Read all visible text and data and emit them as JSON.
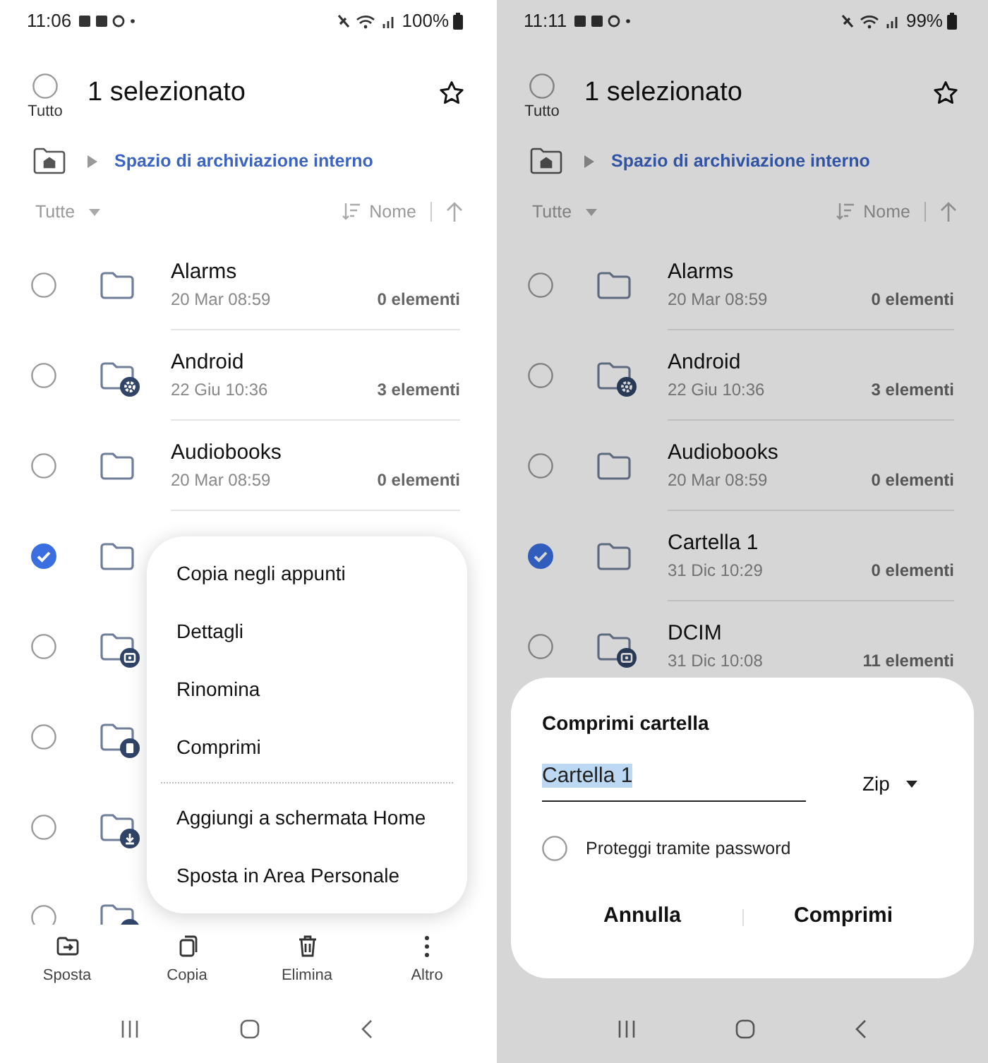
{
  "screens": [
    {
      "dimmed": false,
      "status_bar": {
        "time": "11:06",
        "battery": "100%"
      },
      "header": {
        "select_all": "Tutto",
        "title": "1 selezionato"
      },
      "breadcrumb": "Spazio di archiviazione interno",
      "filter": "Tutte",
      "sort": "Nome",
      "items": [
        {
          "name": "Alarms",
          "date": "20 Mar 08:59",
          "count": "0 elementi",
          "selected": false,
          "kind": "plain"
        },
        {
          "name": "Android",
          "date": "22 Giu 10:36",
          "count": "3 elementi",
          "selected": false,
          "kind": "gear"
        },
        {
          "name": "Audiobooks",
          "date": "20 Mar 08:59",
          "count": "0 elementi",
          "selected": false,
          "kind": "plain"
        },
        {
          "selected": true,
          "kind": "plain"
        },
        {
          "selected": false,
          "kind": "camera"
        },
        {
          "selected": false,
          "kind": "file"
        },
        {
          "selected": false,
          "kind": "download"
        },
        {
          "selected": false,
          "kind": "dot"
        }
      ],
      "menu": {
        "groups": [
          [
            "Copia negli appunti",
            "Dettagli",
            "Rinomina",
            "Comprimi"
          ],
          [
            "Aggiungi a schermata Home",
            "Sposta in Area Personale"
          ]
        ]
      },
      "bottom_bar": [
        {
          "kind": "move",
          "label": "Sposta"
        },
        {
          "kind": "copy",
          "label": "Copia"
        },
        {
          "kind": "delete",
          "label": "Elimina"
        },
        {
          "kind": "more",
          "label": "Altro"
        }
      ]
    },
    {
      "dimmed": true,
      "status_bar": {
        "time": "11:11",
        "battery": "99%"
      },
      "header": {
        "select_all": "Tutto",
        "title": "1 selezionato"
      },
      "breadcrumb": "Spazio di archiviazione interno",
      "filter": "Tutte",
      "sort": "Nome",
      "items": [
        {
          "name": "Alarms",
          "date": "20 Mar 08:59",
          "count": "0 elementi",
          "selected": false,
          "kind": "plain"
        },
        {
          "name": "Android",
          "date": "22 Giu 10:36",
          "count": "3 elementi",
          "selected": false,
          "kind": "gear"
        },
        {
          "name": "Audiobooks",
          "date": "20 Mar 08:59",
          "count": "0 elementi",
          "selected": false,
          "kind": "plain"
        },
        {
          "name": "Cartella 1",
          "date": "31 Dic 10:29",
          "count": "0 elementi",
          "selected": true,
          "kind": "plain"
        },
        {
          "name": "DCIM",
          "date": "31 Dic 10:08",
          "count": "11 elementi",
          "selected": false,
          "kind": "camera"
        }
      ],
      "dialog": {
        "title": "Comprimi cartella",
        "value": "Cartella 1",
        "format": "Zip",
        "password": {
          "label": "Proteggi tramite password",
          "checked": false
        },
        "buttons": [
          "Annulla",
          "Comprimi"
        ]
      }
    }
  ]
}
